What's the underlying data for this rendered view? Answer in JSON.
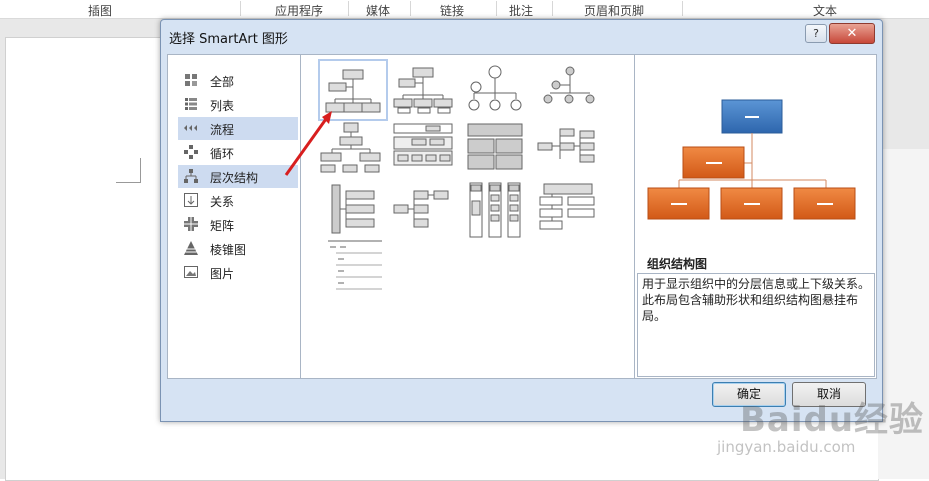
{
  "ribbon": {
    "groups": [
      "插图",
      "应用程序",
      "媒体",
      "链接",
      "批注",
      "页眉和页脚",
      "文本"
    ]
  },
  "dialog": {
    "title": "选择 SmartArt 图形",
    "help_label": "?",
    "close_label": "✕",
    "categories": [
      {
        "label": "全部",
        "icon": "grid-icon"
      },
      {
        "label": "列表",
        "icon": "list-icon"
      },
      {
        "label": "流程",
        "icon": "process-icon"
      },
      {
        "label": "循环",
        "icon": "cycle-icon"
      },
      {
        "label": "层次结构",
        "icon": "hierarchy-icon"
      },
      {
        "label": "关系",
        "icon": "relationship-icon"
      },
      {
        "label": "矩阵",
        "icon": "matrix-icon"
      },
      {
        "label": "棱锥图",
        "icon": "pyramid-icon"
      },
      {
        "label": "图片",
        "icon": "picture-icon"
      }
    ],
    "selected_categories": [
      "流程",
      "层次结构"
    ],
    "preview": {
      "name": "组织结构图",
      "description": "用于显示组织中的分层信息或上下级关系。此布局包含辅助形状和组织结构图悬挂布局。",
      "colors": {
        "top": "#3d7cc0",
        "child": "#e06a28"
      }
    },
    "ok_label": "确定",
    "cancel_label": "取消"
  },
  "watermark": {
    "text": "Baidu经验",
    "url": "jingyan.baidu.com"
  }
}
